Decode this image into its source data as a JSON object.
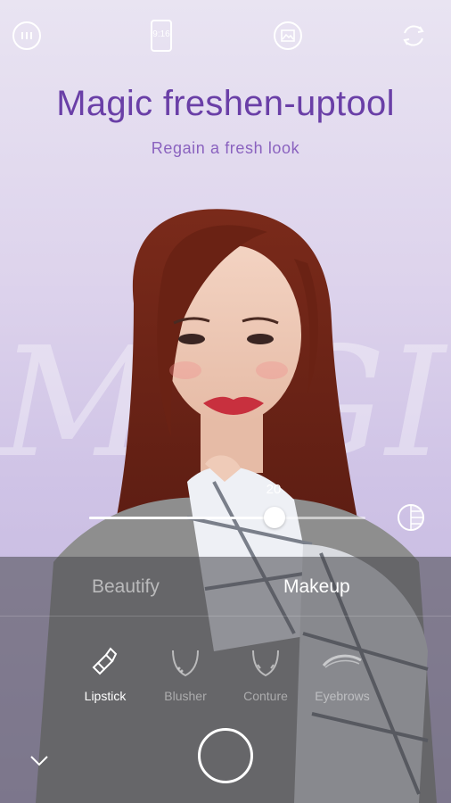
{
  "topbar": {
    "icons": [
      "menu-dots-icon",
      "aspect-ratio-icon",
      "gallery-icon",
      "switch-camera-icon"
    ],
    "aspect_ratio": "9:16"
  },
  "headline": "Magic freshen-uptool",
  "subline": "Regain a fresh look",
  "slider": {
    "value": "20",
    "fraction": 0.67
  },
  "tabs": {
    "beautify": "Beautify",
    "makeup": "Makeup",
    "selected": "Makeup"
  },
  "tools": [
    {
      "label": "Lipstick",
      "icon": "lipstick-icon",
      "active": true
    },
    {
      "label": "Blusher",
      "icon": "blusher-icon",
      "active": false
    },
    {
      "label": "Conture",
      "icon": "contour-icon",
      "active": false
    },
    {
      "label": "Eyebrows",
      "icon": "eyebrow-icon",
      "active": false
    }
  ],
  "colors": {
    "accent": "#6a3fa7",
    "sub": "#8a62bf"
  }
}
